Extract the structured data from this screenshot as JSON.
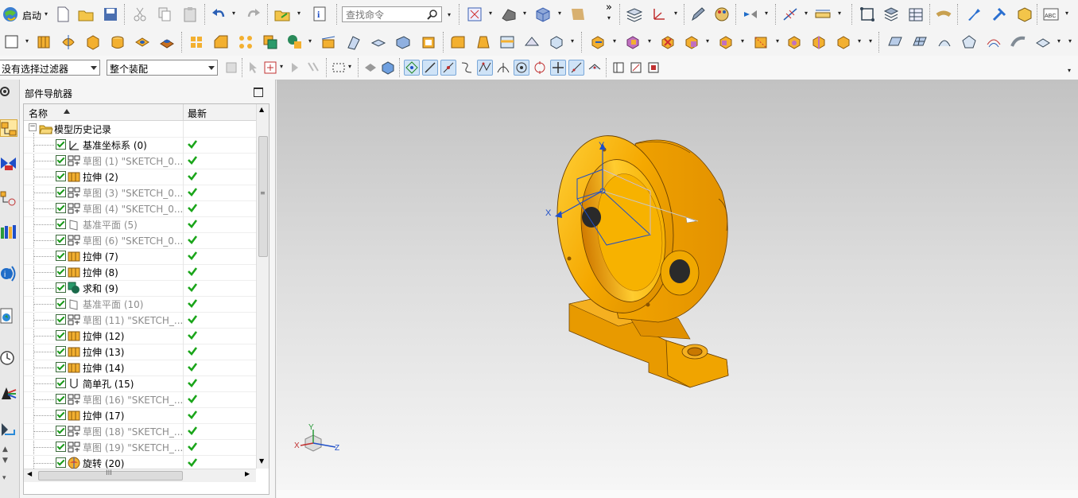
{
  "toolbar": {
    "start_label": "启动",
    "command_search_placeholder": "查找命令",
    "overflow_label": "»"
  },
  "selection_bar": {
    "filter_value": "没有选择过滤器",
    "scope_value": "整个装配"
  },
  "navigator": {
    "title": "部件导航器",
    "columns": [
      "名称",
      "最新"
    ],
    "root_label": "模型历史记录",
    "items": [
      {
        "label": "基准坐标系 (0)",
        "icon": "datum-csys-icon",
        "dim": false
      },
      {
        "label": "草图 (1) \"SKETCH_0...",
        "icon": "sketch-icon",
        "dim": true
      },
      {
        "label": "拉伸 (2)",
        "icon": "extrude-icon",
        "dim": false
      },
      {
        "label": "草图 (3) \"SKETCH_0...",
        "icon": "sketch-icon",
        "dim": true
      },
      {
        "label": "草图 (4) \"SKETCH_0...",
        "icon": "sketch-icon",
        "dim": true
      },
      {
        "label": "基准平面 (5)",
        "icon": "datum-plane-icon",
        "dim": true
      },
      {
        "label": "草图 (6) \"SKETCH_0...",
        "icon": "sketch-icon",
        "dim": true
      },
      {
        "label": "拉伸 (7)",
        "icon": "extrude-icon",
        "dim": false
      },
      {
        "label": "拉伸 (8)",
        "icon": "extrude-icon",
        "dim": false
      },
      {
        "label": "求和 (9)",
        "icon": "unite-icon",
        "dim": false
      },
      {
        "label": "基准平面 (10)",
        "icon": "datum-plane-icon",
        "dim": true
      },
      {
        "label": "草图 (11) \"SKETCH_...",
        "icon": "sketch-icon",
        "dim": true
      },
      {
        "label": "拉伸 (12)",
        "icon": "extrude-icon",
        "dim": false
      },
      {
        "label": "拉伸 (13)",
        "icon": "extrude-icon",
        "dim": false
      },
      {
        "label": "拉伸 (14)",
        "icon": "extrude-icon",
        "dim": false
      },
      {
        "label": "简单孔 (15)",
        "icon": "hole-icon",
        "dim": false
      },
      {
        "label": "草图 (16) \"SKETCH_...",
        "icon": "sketch-icon",
        "dim": true
      },
      {
        "label": "拉伸 (17)",
        "icon": "extrude-icon",
        "dim": false
      },
      {
        "label": "草图 (18) \"SKETCH_...",
        "icon": "sketch-icon",
        "dim": true
      },
      {
        "label": "草图 (19) \"SKETCH_...",
        "icon": "sketch-icon",
        "dim": true
      },
      {
        "label": "旋转 (20)",
        "icon": "revolve-icon",
        "dim": false
      }
    ],
    "scroll_label": "III"
  },
  "viewport": {
    "axis_labels": {
      "x": "X",
      "y": "Y",
      "z": "Z"
    },
    "model_color": "#f2a400",
    "triad_labels": {
      "x": "X",
      "y": "Y",
      "z": "Z"
    }
  },
  "colors": {
    "accent_blue": "#1f4fc8",
    "check_green": "#1aa51a",
    "part_orange": "#f2a400"
  }
}
